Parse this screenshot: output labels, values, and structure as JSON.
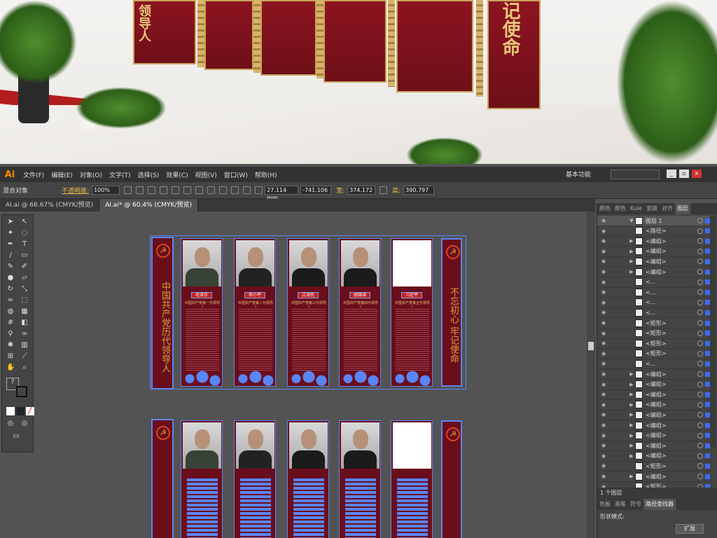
{
  "preview": {
    "left_vertical_text": "领导人",
    "right_vertical_text": "记使命"
  },
  "app": {
    "logo": "Ai",
    "menu": [
      "文件(F)",
      "编辑(E)",
      "对象(O)",
      "文字(T)",
      "选择(S)",
      "效果(C)",
      "视图(V)",
      "窗口(W)",
      "帮助(H)"
    ],
    "workspace": "基本功能",
    "search_placeholder": "",
    "control": {
      "mode_label": "混合对象",
      "opacity_label": "不透明度:",
      "opacity_value": "100%",
      "x_value": "27.114 mm",
      "y_value": "-741.106",
      "w_label": "宽:",
      "w_value": "374.172",
      "h_label": "高:",
      "h_value": "390.797"
    },
    "tabs": [
      "AI.ai @ 66.67% (CMYK/预览)",
      "AI.ai* @ 60.4% (CMYK/预览)"
    ],
    "close_glyph": "×"
  },
  "artwork": {
    "left_side_text": "中国共产党历代领导人",
    "right_side_text": "不忘初心 牢记使命",
    "emblem": "☭",
    "columns": [
      {
        "badge": "毛泽东",
        "subtitle": "中国共产党第一代领导人"
      },
      {
        "badge": "邓小平",
        "subtitle": "中国共产党第二代领导人"
      },
      {
        "badge": "江泽民",
        "subtitle": "中国共产党第三代领导人"
      },
      {
        "badge": "胡锦涛",
        "subtitle": "中国共产党第四代领导人"
      },
      {
        "badge": "习近平",
        "subtitle": "中国共产党第五代领导人"
      }
    ]
  },
  "panel": {
    "tabs": [
      "颜色",
      "颜色",
      "Kule",
      "变换",
      "对齐",
      "图层"
    ],
    "active_tab": "图层",
    "layers": [
      {
        "name": "图层 1",
        "expand": "▼"
      },
      {
        "name": "<路径>",
        "expand": ""
      },
      {
        "name": "<编组>",
        "expand": "▶"
      },
      {
        "name": "<编组>",
        "expand": "▶"
      },
      {
        "name": "<编组>",
        "expand": "▶"
      },
      {
        "name": "<编组>",
        "expand": "▶"
      },
      {
        "name": "<...",
        "expand": ""
      },
      {
        "name": "<...",
        "expand": ""
      },
      {
        "name": "<...",
        "expand": ""
      },
      {
        "name": "<...",
        "expand": ""
      },
      {
        "name": "<矩形>",
        "expand": ""
      },
      {
        "name": "<矩形>",
        "expand": ""
      },
      {
        "name": "<矩形>",
        "expand": ""
      },
      {
        "name": "<矩形>",
        "expand": ""
      },
      {
        "name": "<...",
        "expand": ""
      },
      {
        "name": "<编组>",
        "expand": "▶"
      },
      {
        "name": "<编组>",
        "expand": "▶"
      },
      {
        "name": "<编组>",
        "expand": "▶"
      },
      {
        "name": "<编组>",
        "expand": "▶"
      },
      {
        "name": "<编组>",
        "expand": "▶"
      },
      {
        "name": "<编组>",
        "expand": "▶"
      },
      {
        "name": "<编组>",
        "expand": "▶"
      },
      {
        "name": "<编组>",
        "expand": "▶"
      },
      {
        "name": "<编组>",
        "expand": "▶"
      },
      {
        "name": "<矩形>",
        "expand": ""
      },
      {
        "name": "<编组>",
        "expand": "▶"
      },
      {
        "name": "<矩形>",
        "expand": ""
      }
    ],
    "layer_count": "1 个图层",
    "tabs2": [
      "色板",
      "画笔",
      "符号",
      "路径查找器"
    ],
    "shape_mode": "形状模式:",
    "expand_button": "扩展"
  }
}
